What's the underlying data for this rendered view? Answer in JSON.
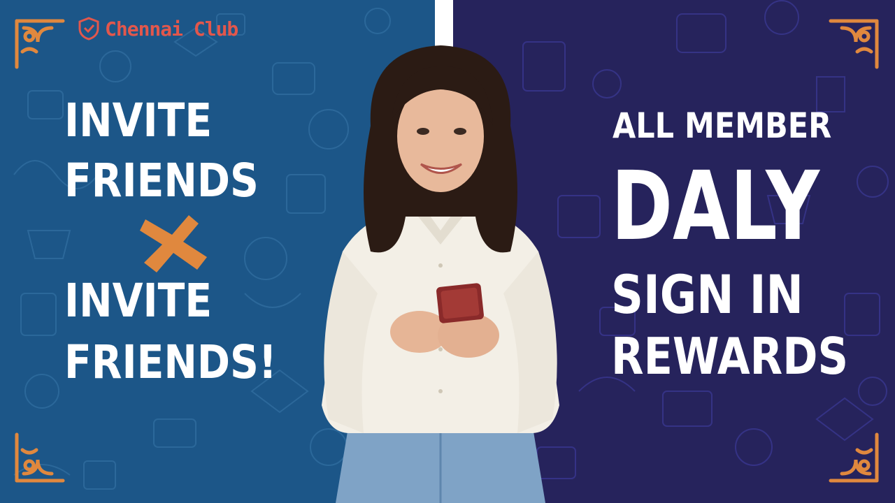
{
  "brand": {
    "name": "Chennai Club",
    "icon": "shield-icon",
    "color": "#e2574c"
  },
  "left_panel": {
    "line1": "INVITE",
    "line2": "FRIENDS",
    "line3": "INVITE",
    "line4": "FRIENDS!",
    "background": "#1c5688",
    "cross_color": "#e0883e"
  },
  "right_panel": {
    "line1": "ALL MEMBER",
    "line2": "DALY",
    "line3": "SIGN IN",
    "line4": "REWARDS",
    "background": "#26235c"
  },
  "decor": {
    "corner_color": "#e0883e",
    "divider_color": "#ffffff"
  }
}
